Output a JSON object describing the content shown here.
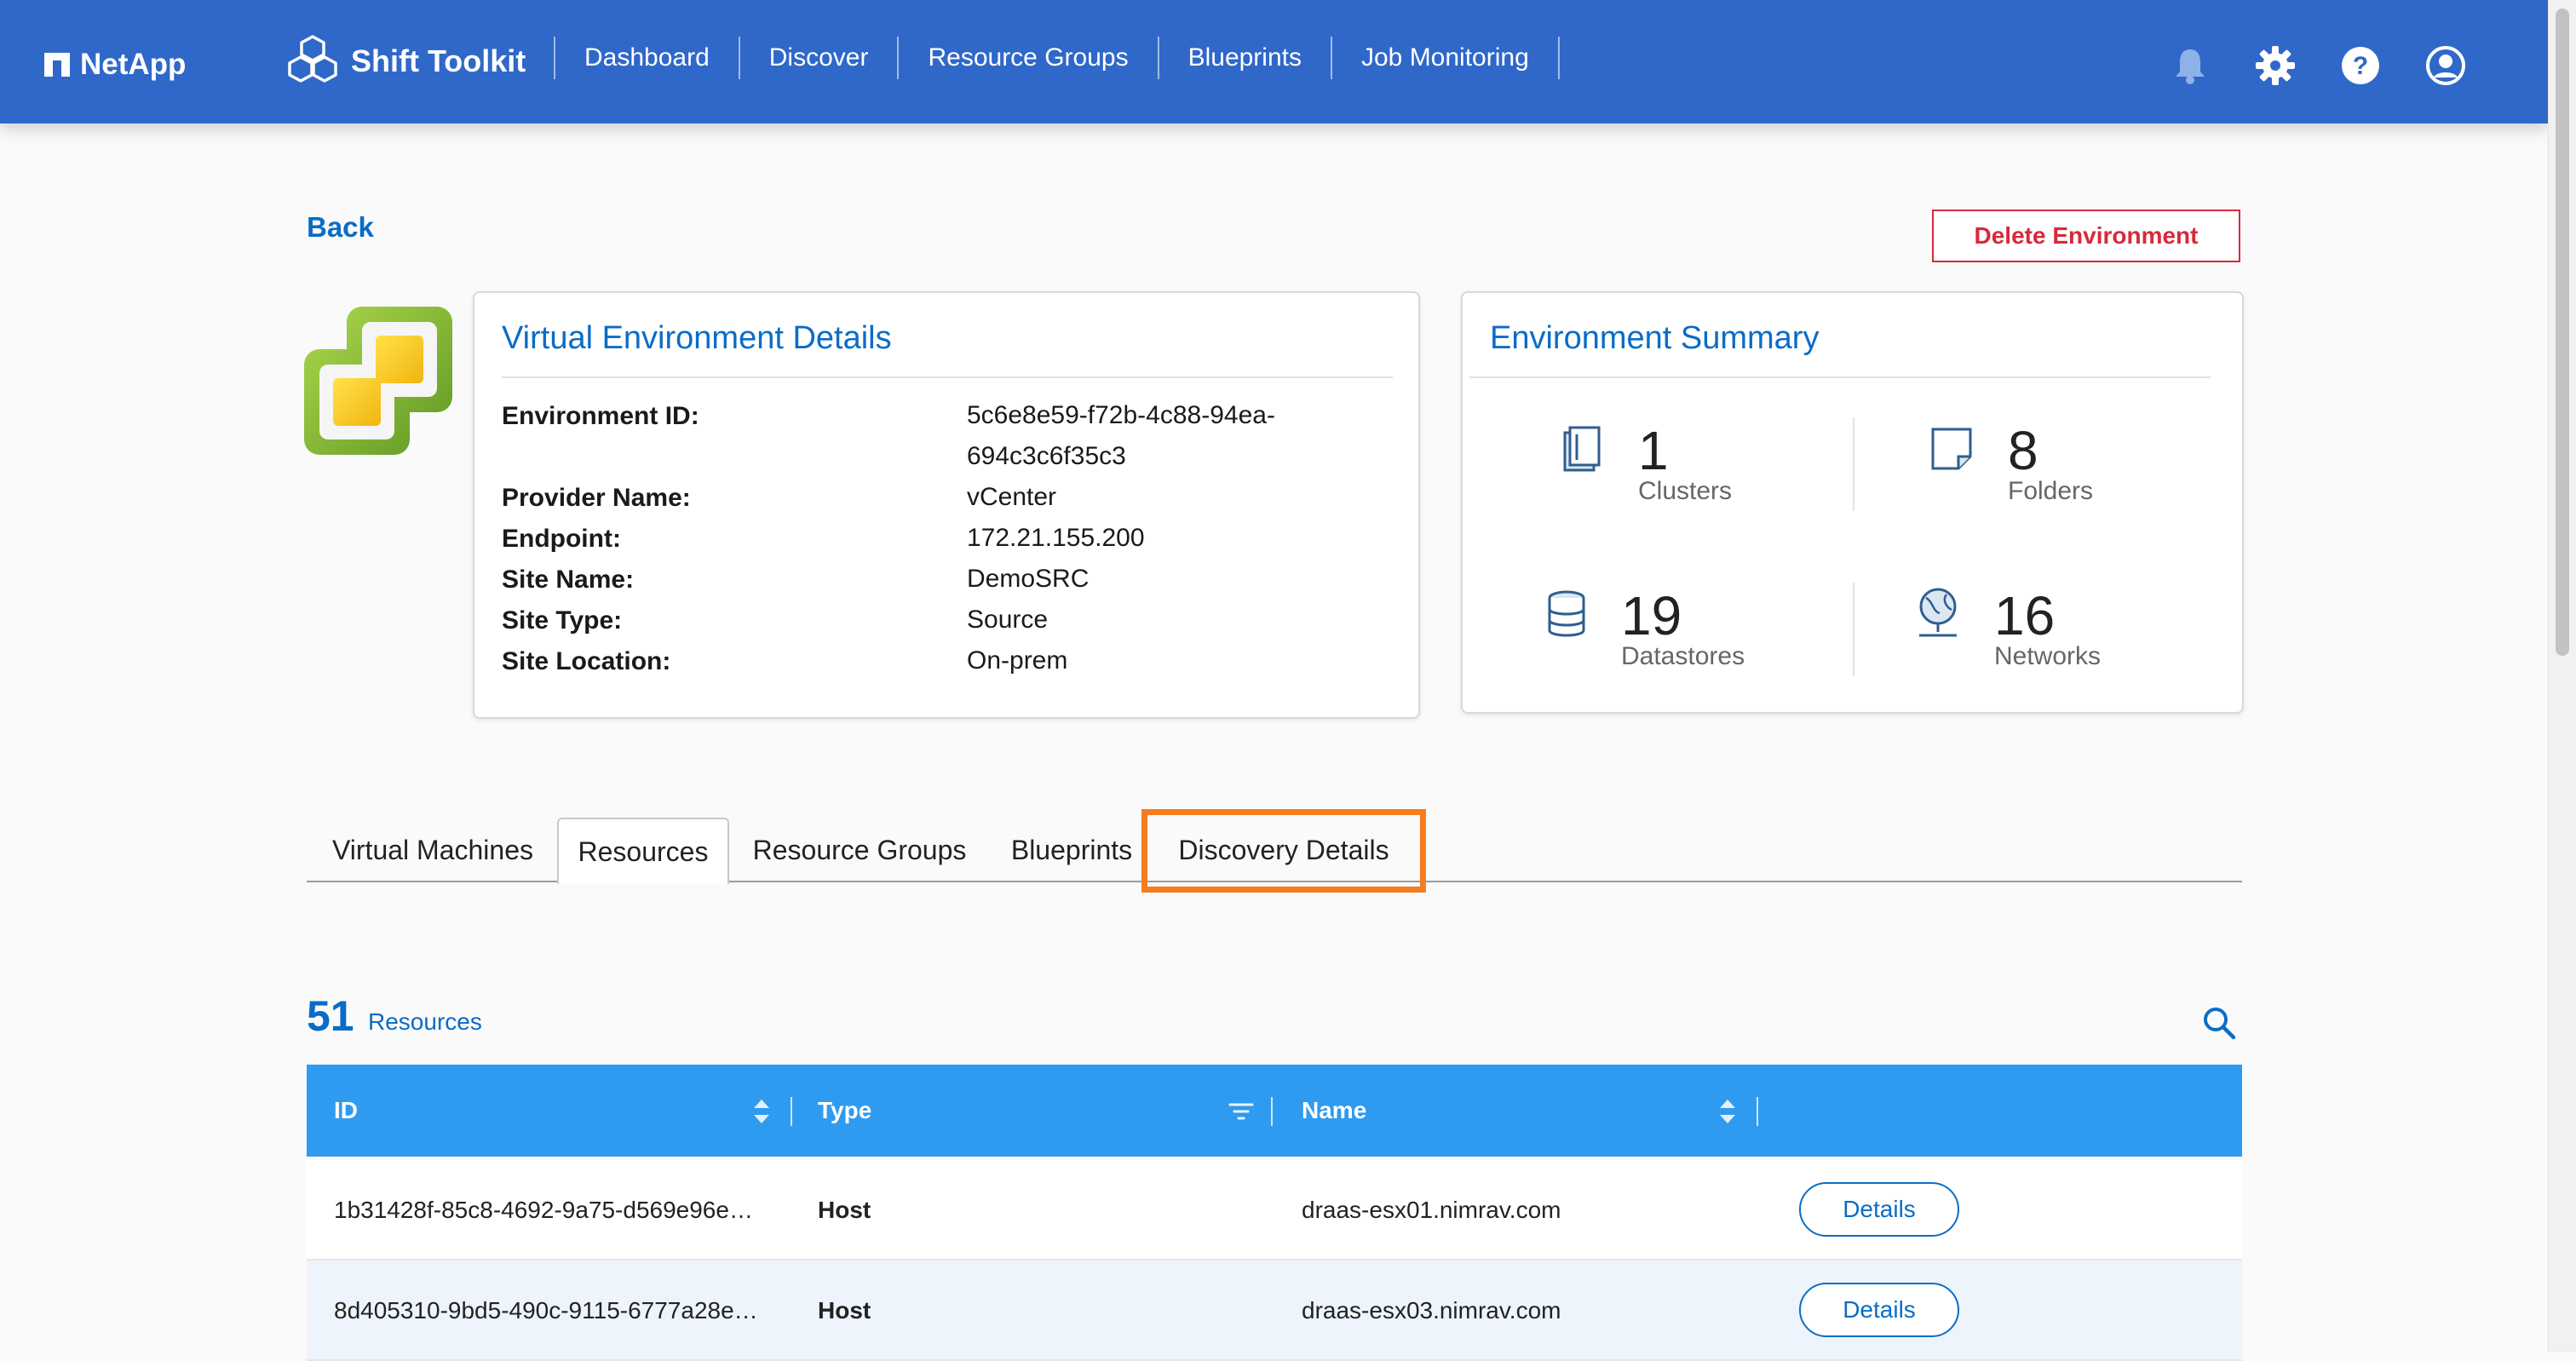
{
  "brand": {
    "name": "NetApp"
  },
  "app": {
    "title": "Shift Toolkit"
  },
  "nav": {
    "items": [
      "Dashboard",
      "Discover",
      "Resource Groups",
      "Blueprints",
      "Job Monitoring"
    ]
  },
  "topbar_icons": [
    "bell-icon",
    "gear-icon",
    "help-icon",
    "user-icon"
  ],
  "page": {
    "back_label": "Back",
    "delete_label": "Delete Environment"
  },
  "details": {
    "title": "Virtual Environment Details",
    "rows": [
      {
        "key": "Environment ID:",
        "value": "5c6e8e59-f72b-4c88-94ea-694c3c6f35c3"
      },
      {
        "key": "Provider Name:",
        "value": "vCenter"
      },
      {
        "key": "Endpoint:",
        "value": "172.21.155.200"
      },
      {
        "key": "Site Name:",
        "value": "DemoSRC"
      },
      {
        "key": "Site Type:",
        "value": "Source"
      },
      {
        "key": "Site Location:",
        "value": "On-prem"
      }
    ]
  },
  "summary": {
    "title": "Environment Summary",
    "items": [
      {
        "count": "1",
        "label": "Clusters",
        "icon": "cluster-icon"
      },
      {
        "count": "8",
        "label": "Folders",
        "icon": "folder-icon"
      },
      {
        "count": "19",
        "label": "Datastores",
        "icon": "datastore-icon"
      },
      {
        "count": "16",
        "label": "Networks",
        "icon": "network-icon"
      }
    ]
  },
  "tabs": {
    "items": [
      "Virtual Machines",
      "Resources",
      "Resource Groups",
      "Blueprints",
      "Discovery Details"
    ],
    "active": "Resources",
    "highlighted": "Discovery Details"
  },
  "resources": {
    "count": "51",
    "count_label": "Resources",
    "columns": [
      "ID",
      "Type",
      "Name"
    ],
    "rows": [
      {
        "id": "1b31428f-85c8-4692-9a75-d569e96e…",
        "type": "Host",
        "name": "draas-esx01.nimrav.com",
        "action": "Details"
      },
      {
        "id": "8d405310-9bd5-490c-9115-6777a28e…",
        "type": "Host",
        "name": "draas-esx03.nimrav.com",
        "action": "Details"
      }
    ]
  },
  "colors": {
    "header_blue": "#2f68c9",
    "table_header": "#2f9bf0",
    "link_blue": "#0a6cc7",
    "danger": "#d62a3a",
    "highlight": "#f57c1f"
  }
}
